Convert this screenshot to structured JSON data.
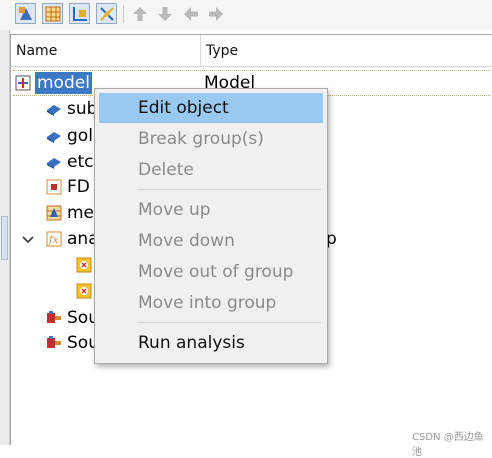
{
  "toolbar": {
    "buttons": [
      {
        "name": "add-structure-icon"
      },
      {
        "name": "add-mesh-icon"
      },
      {
        "name": "add-monitor-icon"
      },
      {
        "name": "add-source-icon"
      }
    ],
    "arrows": [
      "arrow-up-icon",
      "arrow-down-icon",
      "arrow-left-icon",
      "arrow-right-icon"
    ]
  },
  "tree": {
    "columns": [
      "Name",
      "Type"
    ],
    "rows": [
      {
        "label": "model",
        "type": "Model",
        "icon": "model-icon",
        "selected": true
      },
      {
        "label": "sub",
        "icon": "structure-icon"
      },
      {
        "label": "gol",
        "icon": "structure-icon"
      },
      {
        "label": "etc",
        "icon": "structure-icon"
      },
      {
        "label": "FD",
        "icon": "fdtd-icon"
      },
      {
        "label": "me",
        "icon": "mesh-icon"
      },
      {
        "label": "ana",
        "icon": "analysis-group-icon",
        "expanded": true,
        "type_fragment": "p"
      },
      {
        "label": "",
        "icon": "monitor-icon"
      },
      {
        "label": "",
        "icon": "monitor-icon"
      },
      {
        "label": "Sou",
        "icon": "source-icon"
      },
      {
        "label": "Sou",
        "icon": "source-icon"
      }
    ]
  },
  "context_menu": {
    "items": [
      {
        "label": "Edit object",
        "enabled": true,
        "highlighted": true
      },
      {
        "label": "Break group(s)",
        "enabled": false
      },
      {
        "label": "Delete",
        "enabled": false
      },
      {
        "label": "Move up",
        "enabled": false
      },
      {
        "label": "Move down",
        "enabled": false
      },
      {
        "label": "Move out of group",
        "enabled": false
      },
      {
        "label": "Move into group",
        "enabled": false
      },
      {
        "label": "Run analysis",
        "enabled": true
      }
    ]
  },
  "watermark": "CSDN @西边鱼池",
  "colors": {
    "selection": "#3b78c6",
    "menu_highlight": "#99c8f0",
    "disabled_text": "#8a8a8a"
  }
}
